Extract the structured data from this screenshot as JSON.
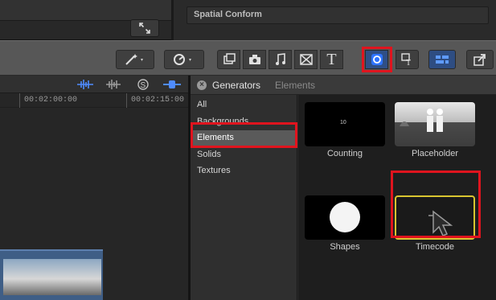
{
  "inspector": {
    "section_title": "Spatial Conform"
  },
  "timeline": {
    "ruler_labels": [
      "00:02:00:00",
      "00:02:15:00"
    ],
    "header_icons": [
      "audio-waveform-icon",
      "waveform-icon",
      "solo-icon",
      "snapping-icon"
    ]
  },
  "toolbar": {
    "buttons": [
      "magic-wand-icon",
      "retime-icon",
      "photos-icon",
      "camera-icon",
      "music-icon",
      "transitions-icon",
      "titles-icon",
      "generators-icon",
      "themes-icon",
      "effects-icon",
      "share-icon"
    ],
    "titles_glyph": "T",
    "highlight_color": "#e0141e"
  },
  "browser": {
    "title": "Generators",
    "breadcrumb": "Elements",
    "categories": [
      "All",
      "Backgrounds",
      "Elements",
      "Solids",
      "Textures"
    ],
    "selected_category": "Elements",
    "items": [
      {
        "name": "Counting",
        "overlay": "10"
      },
      {
        "name": "Placeholder",
        "overlay": ""
      },
      {
        "name": "Shapes",
        "overlay": ""
      },
      {
        "name": "Timecode",
        "overlay": ""
      }
    ]
  }
}
